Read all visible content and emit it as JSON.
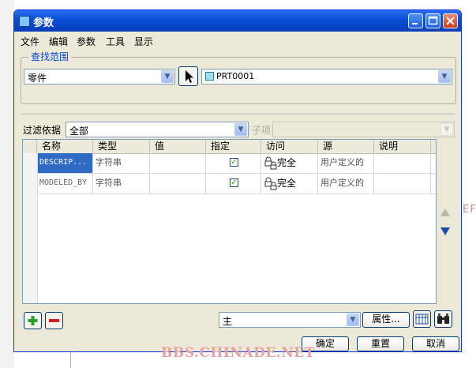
{
  "window": {
    "title": "参数"
  },
  "menu": [
    "文件",
    "编辑",
    "参数",
    "工具",
    "显示"
  ],
  "search_scope": {
    "label": "查找范围",
    "type_value": "零件",
    "model_value": "PRT0001"
  },
  "filter": {
    "label": "过滤依据",
    "value": "全部",
    "subitem_label": "子项"
  },
  "table": {
    "columns": [
      "名称",
      "类型",
      "值",
      "指定",
      "访问",
      "源",
      "说明"
    ],
    "rows": [
      {
        "name": "DESCRIP...",
        "type": "字符串",
        "value": "",
        "designated": true,
        "access": "完全",
        "source": "用户定义的",
        "description": ""
      },
      {
        "name": "MODELED_BY",
        "type": "字符串",
        "value": "",
        "designated": true,
        "access": "完全",
        "source": "用户定义的",
        "description": ""
      }
    ]
  },
  "bottom": {
    "add_label": "+",
    "remove_label": "−",
    "main_value": "主",
    "properties_label": "属性..."
  },
  "dialog_buttons": {
    "ok": "确定",
    "reset": "重置",
    "cancel": "取消"
  },
  "background": {
    "fragment_text": "EF"
  },
  "watermark": "BBS.CHINADE.NET"
}
